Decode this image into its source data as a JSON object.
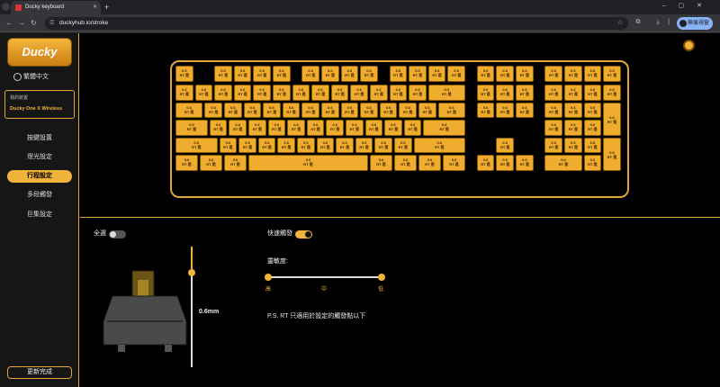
{
  "browser": {
    "tab_title": "Ducky keyboard",
    "url": "duckyhub.io/stroke",
    "profile_label": "無痕視窗"
  },
  "sidebar": {
    "logo_text": "Ducky",
    "language": "繁體中文",
    "device_title": "我的裝置",
    "device_name": "Ducky One X Wireless",
    "nav": [
      "按鍵設置",
      "燈光設定",
      "行程設定",
      "多段觸發",
      "巨集設定"
    ],
    "active_index": 2,
    "finish_button": "更新完成"
  },
  "keyboard": {
    "key_value": "0.6",
    "key_mode": "RT 是"
  },
  "controls": {
    "select_all": "全選",
    "select_all_on": false,
    "rapid_trigger": "快速觸發",
    "rapid_trigger_on": true,
    "sensitivity_label": "靈敏度:",
    "sensitivity_ticks": [
      "高",
      "中",
      "低"
    ],
    "travel_value": "0.6mm",
    "note": "P.S. RT 只適用於設定的觸發點以下"
  },
  "colors": {
    "accent": "#f0b43a",
    "key": "#f0ac2e",
    "background": "#000000"
  }
}
